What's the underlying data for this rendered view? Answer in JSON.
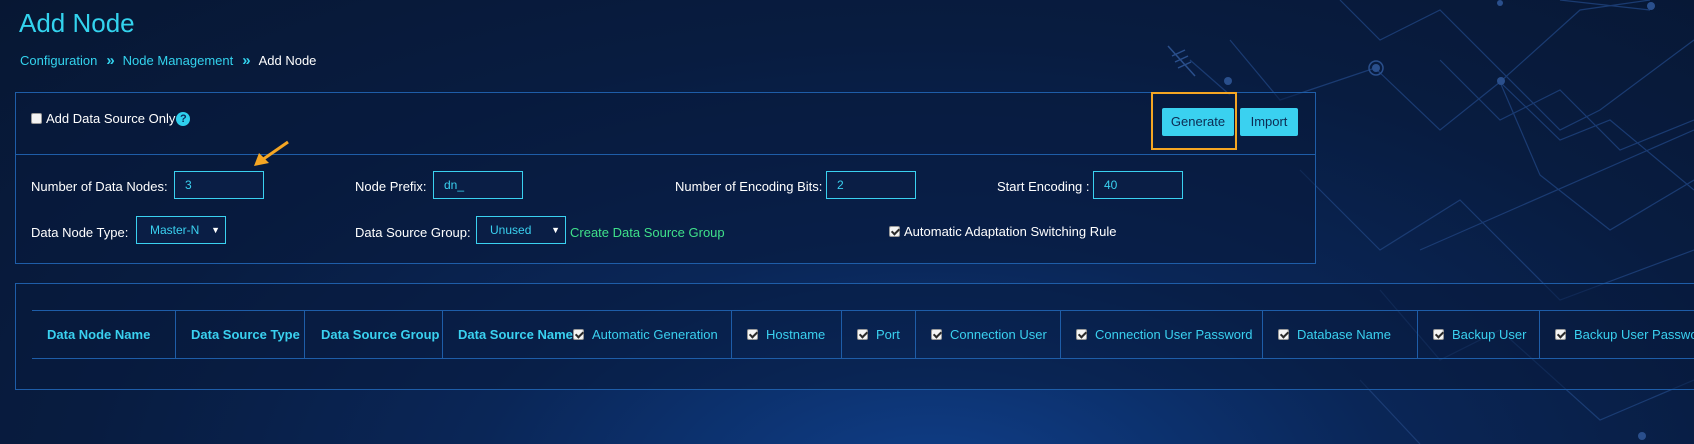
{
  "page": {
    "title": "Add Node"
  },
  "breadcrumb": {
    "item1": "Configuration",
    "item2": "Node Management",
    "item3": "Add Node",
    "separator": "»"
  },
  "form": {
    "add_data_source_only": {
      "label": "Add Data Source Only",
      "checked": false,
      "help": "?"
    },
    "generate_button": "Generate",
    "import_button": "Import",
    "num_data_nodes": {
      "label": "Number of Data Nodes:",
      "value": "3"
    },
    "node_prefix": {
      "label": "Node Prefix:",
      "value": "dn_"
    },
    "num_encoding_bits": {
      "label": "Number of Encoding Bits:",
      "value": "2"
    },
    "start_encoding": {
      "label": "Start Encoding :",
      "value": "40"
    },
    "data_node_type": {
      "label": "Data Node Type:",
      "value": "Master-N"
    },
    "data_source_group": {
      "label": "Data Source Group:",
      "value": "Unused"
    },
    "create_data_source_group": "Create Data Source Group",
    "auto_switching": {
      "label": "Automatic Adaptation Switching Rule",
      "checked": true
    }
  },
  "table": {
    "headers": [
      {
        "label": "Data Node Name",
        "checkbox": false
      },
      {
        "label": "Data Source Type",
        "checkbox": false
      },
      {
        "label": "Data Source Group",
        "checkbox": false
      },
      {
        "label": "Data Source Name",
        "checkbox": false
      },
      {
        "label": "Automatic Generation",
        "checkbox": true
      },
      {
        "label": "Hostname",
        "checkbox": true
      },
      {
        "label": "Port",
        "checkbox": true
      },
      {
        "label": "Connection User",
        "checkbox": true
      },
      {
        "label": "Connection User Password",
        "checkbox": true
      },
      {
        "label": "Database Name",
        "checkbox": true
      },
      {
        "label": "Backup User",
        "checkbox": true
      },
      {
        "label": "Backup User Password",
        "checkbox": true
      }
    ]
  },
  "colors": {
    "accent": "#3ad1f0",
    "highlight": "#f5a623",
    "link_green": "#3fe08a",
    "border": "#1e5da8"
  }
}
